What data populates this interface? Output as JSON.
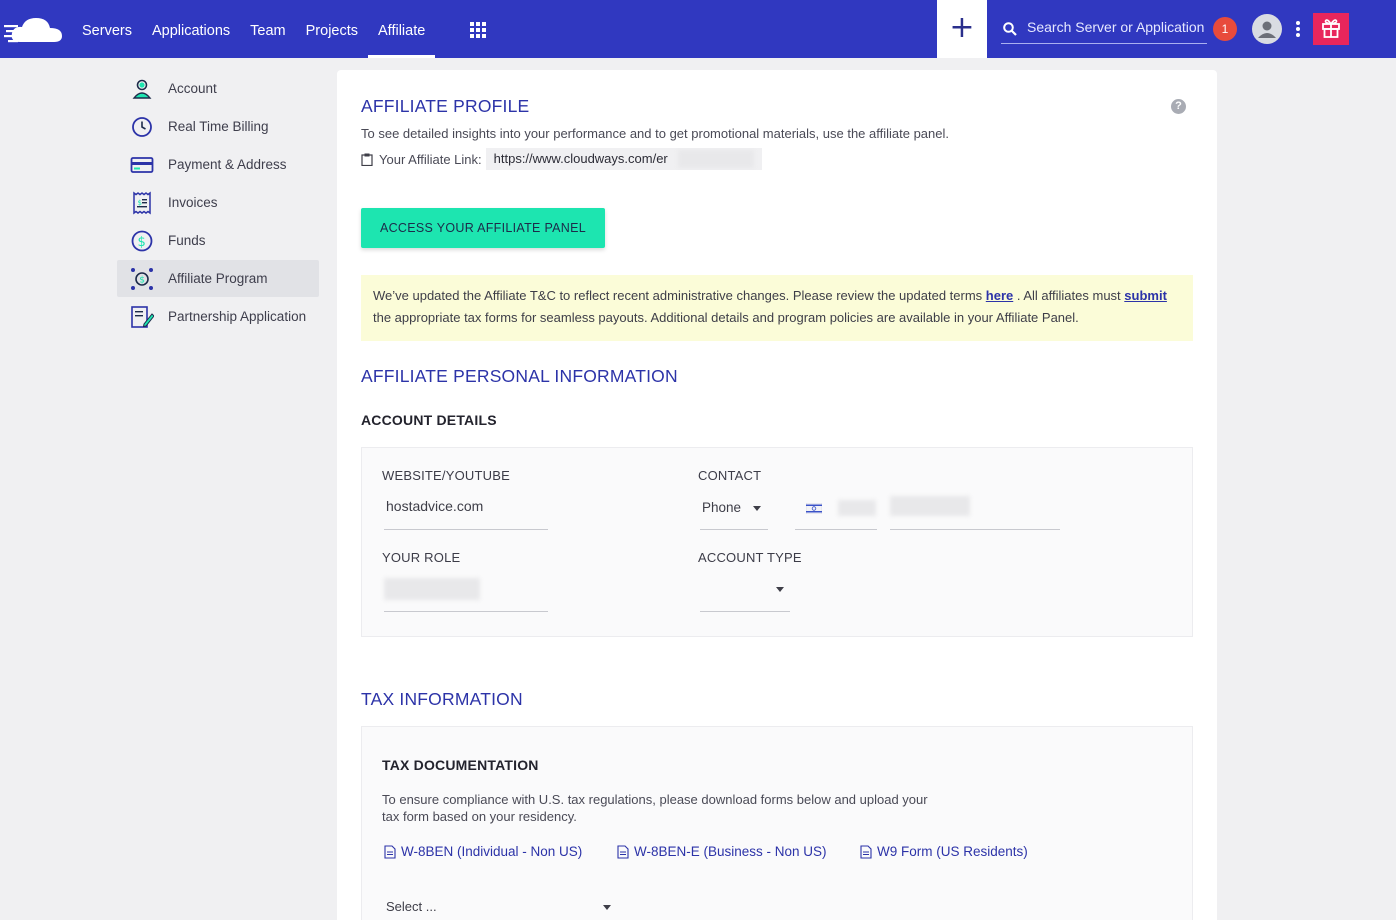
{
  "topbar": {
    "nav": [
      "Servers",
      "Applications",
      "Team",
      "Projects",
      "Affiliate"
    ],
    "active_nav": "Affiliate",
    "plus_label": "+",
    "search_placeholder": "Search Server or Application",
    "notification_count": "1",
    "colors": {
      "bar": "#3038c0",
      "gift": "#e8265c",
      "badge": "#e84b3c"
    }
  },
  "sidebar": {
    "items": [
      {
        "label": "Account",
        "icon": "user-icon"
      },
      {
        "label": "Real Time Billing",
        "icon": "clock-icon"
      },
      {
        "label": "Payment & Address",
        "icon": "credit-card-icon"
      },
      {
        "label": "Invoices",
        "icon": "receipt-icon"
      },
      {
        "label": "Funds",
        "icon": "dollar-icon"
      },
      {
        "label": "Affiliate Program",
        "icon": "affiliate-icon",
        "active": true
      },
      {
        "label": "Partnership Application",
        "icon": "document-pen-icon"
      }
    ]
  },
  "main": {
    "profile_title": "AFFILIATE PROFILE",
    "profile_desc": "To see detailed insights into your performance and to get promotional materials, use the affiliate panel.",
    "link_label": "Your Affiliate Link:",
    "link_value": "https://www.cloudways.com/er",
    "panel_button": "ACCESS YOUR AFFILIATE PANEL",
    "notice": {
      "part1": "We’ve updated the Affiliate T&C to reflect recent administrative changes. Please review the updated terms ",
      "link1": "here",
      "part2": " . All affiliates must ",
      "link2": "submit",
      "part3": "  the appropriate tax forms for seamless payouts. Additional details and program policies are available in your Affiliate Panel."
    },
    "personal_title": "AFFILIATE PERSONAL INFORMATION",
    "account_details_title": "ACCOUNT DETAILS",
    "fields": {
      "website_label": "WEBSITE/YOUTUBE",
      "website_value": "hostadvice.com",
      "contact_label": "CONTACT",
      "contact_type": "Phone",
      "role_label": "YOUR ROLE",
      "account_type_label": "ACCOUNT TYPE"
    },
    "tax_title": "TAX INFORMATION",
    "tax_doc_title": "TAX DOCUMENTATION",
    "tax_desc": "To ensure compliance with U.S. tax regulations, please download forms below and upload your tax form based on your residency.",
    "tax_forms": [
      "W-8BEN (Individual - Non US)",
      "W-8BEN-E (Business - Non US)",
      "W9 Form (US Residents)"
    ],
    "select_placeholder": "Select ..."
  }
}
